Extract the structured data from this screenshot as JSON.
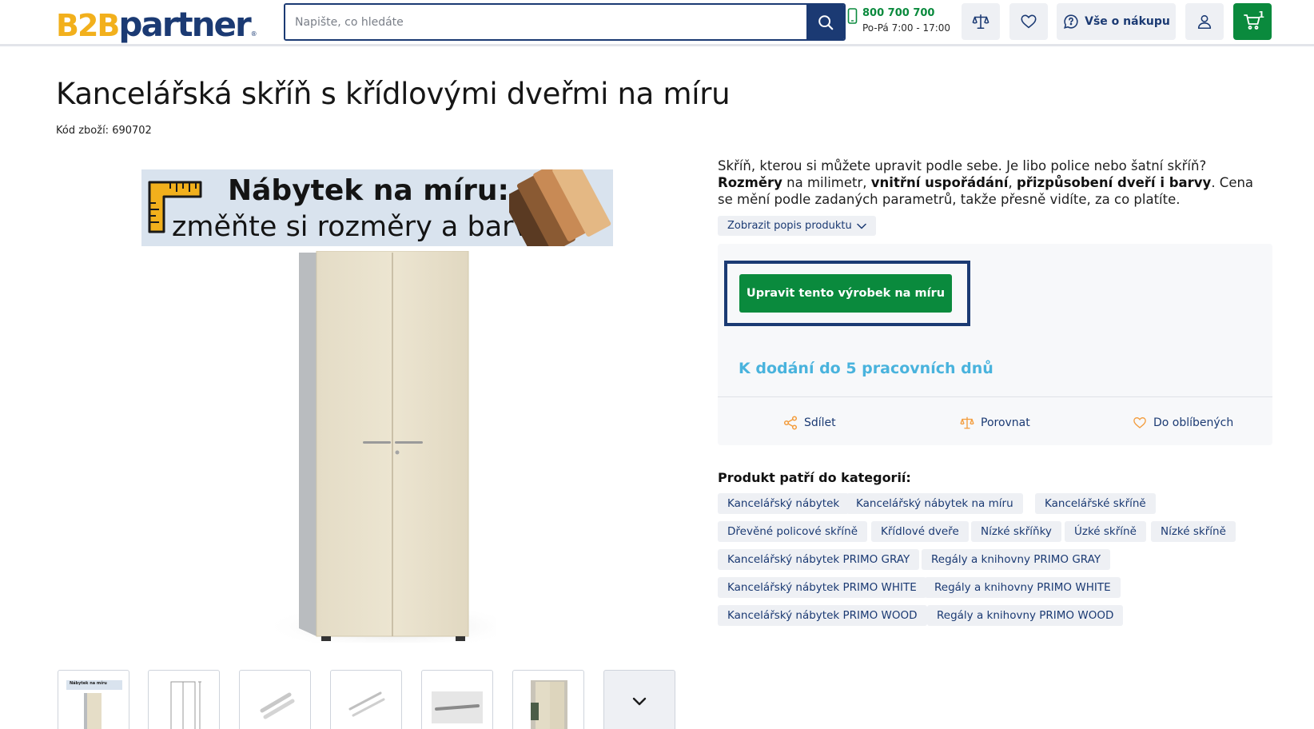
{
  "header": {
    "logo_b2b": "B2B",
    "logo_partner": "partner",
    "search_placeholder": "Napište, co hledáte",
    "phone_number": "800 700 700",
    "phone_hours": "Po-Pá 7:00 - 17:00",
    "info_button_label": "Vše o nákupu",
    "cart_count": "1",
    "colors": {
      "brand_navy": "#1b3a73",
      "brand_yellow": "#f2b01c",
      "green": "#0a8a3d"
    }
  },
  "product": {
    "title": "Kancelářská skříň s křídlovými dveřmi na míru",
    "sku": "Kód zboží: 690702",
    "banner_line1": "Nábytek na míru:",
    "banner_line2": "změňte si rozměry a barvy",
    "description": {
      "p1": "Skříň, kterou si můžete upravit podle sebe. Je libo police nebo šatní skříň? ",
      "b1": "Rozměry",
      "p2": " na milimetr, ",
      "b2": "vnitřní uspořádání",
      "p3": ", ",
      "b3": "přizpůsobení dveří i barvy",
      "p4": ". Cena se mění podle zadaných parametrů, takže přesně vidíte, za co platíte."
    },
    "show_description_label": "Zobrazit popis produktu",
    "customize_button_label": "Upravit tento výrobek na míru",
    "delivery_text": "K dodání do 5 pracovních dnů",
    "actions": {
      "share": "Sdílet",
      "compare": "Porovnat",
      "favorite": "Do oblíbených"
    },
    "categories_heading": "Produkt patří do kategorií:",
    "categories": [
      "Kancelářský nábytek",
      "Kancelářský nábytek na míru",
      "Kancelářské skříně",
      "Dřevěné policové skříně",
      "Křídlové dveře",
      "Nízké skříňky",
      "Úzké skříně",
      "Nízké skříně",
      "Kancelářský nábytek PRIMO GRAY",
      "Regály a knihovny PRIMO GRAY",
      "Kancelářský nábytek PRIMO WHITE",
      "Regály a knihovny PRIMO WHITE",
      "Kancelářský nábytek PRIMO WOOD",
      "Regály a knihovny PRIMO WOOD"
    ],
    "thumbnail_mini_text": "Nábytek na míru"
  }
}
